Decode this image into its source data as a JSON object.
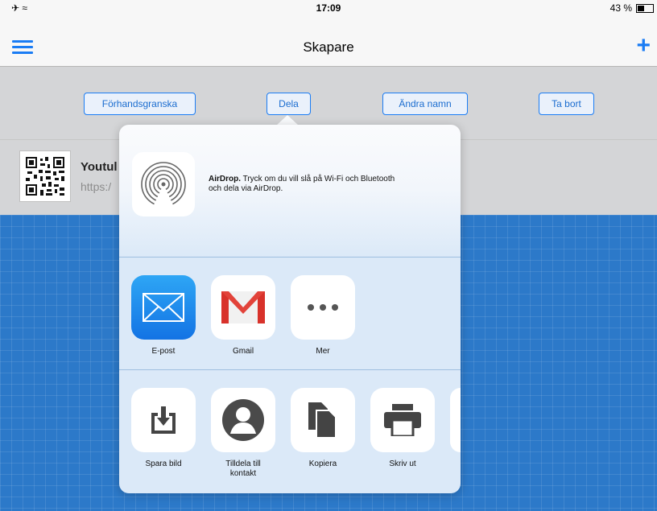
{
  "status_bar": {
    "left_icons": "✈ ≈",
    "time": "17:09",
    "battery_label": "43 %",
    "battery_level": 0.43
  },
  "nav": {
    "title": "Skapare",
    "menu_icon": "hamburger-menu-icon",
    "add_icon": "plus-icon"
  },
  "toolbar": {
    "preview_label": "Förhandsgranska",
    "share_label": "Dela",
    "rename_label": "Ändra namn",
    "delete_label": "Ta bort"
  },
  "list_item": {
    "title": "Youtul",
    "subtitle": "https:/"
  },
  "share_sheet": {
    "airdrop_title": "AirDrop.",
    "airdrop_line1": " Tryck om du vill slå på Wi-Fi och Bluetooth",
    "airdrop_line2": "och dela via AirDrop.",
    "apps": [
      {
        "label": "E-post",
        "icon": "mail-icon"
      },
      {
        "label": "Gmail",
        "icon": "gmail-icon"
      },
      {
        "label": "Mer",
        "icon": "more-dots-icon"
      }
    ],
    "actions": [
      {
        "label": "Spara bild",
        "icon": "save-image-icon"
      },
      {
        "label_line1": "Tilldela till",
        "label_line2": "kontakt",
        "icon": "contact-icon"
      },
      {
        "label": "Kopiera",
        "icon": "copy-icon"
      },
      {
        "label": "Skriv ut",
        "icon": "print-icon"
      }
    ]
  },
  "colors": {
    "accent": "#1a7cf4",
    "blueprint": "#2c79c9",
    "toolbar_bg": "#d4d5d7"
  }
}
